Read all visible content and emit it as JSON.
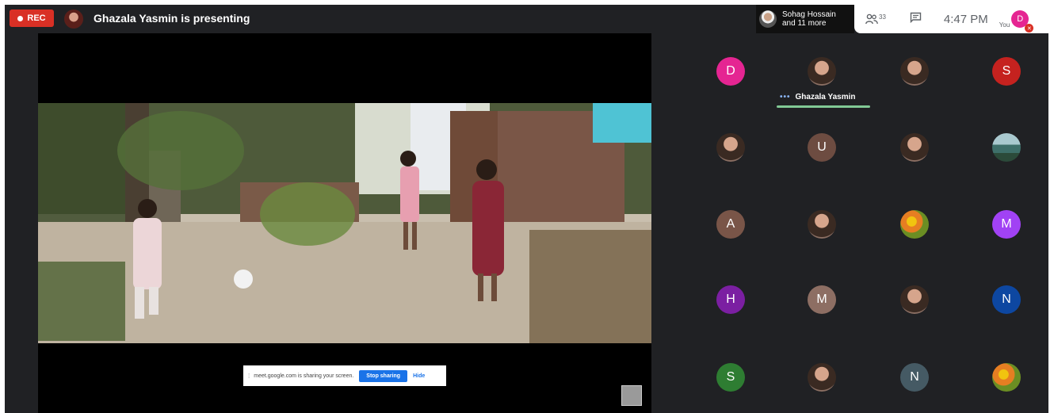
{
  "top_bar": {
    "rec_label": "REC",
    "presenting_text": "Ghazala Yasmin is presenting",
    "speaker_name": "Sohag Hossain",
    "speaker_more": "and 11 more",
    "participants_count": "33",
    "time": "4:47 PM",
    "you_label": "You",
    "you_initial": "D"
  },
  "share_bar": {
    "message": "meet.google.com is sharing your screen.",
    "stop_label": "Stop sharing",
    "hide_label": "Hide"
  },
  "grid": {
    "tiles": [
      {
        "initial": "D",
        "color": "#e52592"
      },
      {
        "initial": "",
        "name": "Ghazala Yasmin",
        "photo": "portrait"
      },
      {
        "initial": "",
        "photo": "portrait"
      },
      {
        "initial": "S",
        "color": "#c5221f"
      },
      {
        "initial": "",
        "photo": "portrait"
      },
      {
        "initial": "U",
        "color": "#6d4c41"
      },
      {
        "initial": "",
        "photo": "portrait"
      },
      {
        "initial": "",
        "photo": "landscape"
      },
      {
        "initial": "A",
        "color": "#795548"
      },
      {
        "initial": "",
        "photo": "portrait"
      },
      {
        "initial": "",
        "photo": "flowers"
      },
      {
        "initial": "M",
        "color": "#a142f4"
      },
      {
        "initial": "H",
        "color": "#7b1fa2"
      },
      {
        "initial": "M",
        "color": "#8d6e63"
      },
      {
        "initial": "",
        "photo": "portrait"
      },
      {
        "initial": "N",
        "color": "#0d47a1"
      },
      {
        "initial": "S",
        "color": "#2e7d32"
      },
      {
        "initial": "",
        "photo": "portrait"
      },
      {
        "initial": "N",
        "color": "#455a64"
      },
      {
        "initial": "",
        "photo": "flowers"
      }
    ]
  },
  "colors": {
    "rec": "#d93025",
    "stop_button": "#1a73e8",
    "speaker_bar": "#81c995",
    "background": "#202124"
  }
}
